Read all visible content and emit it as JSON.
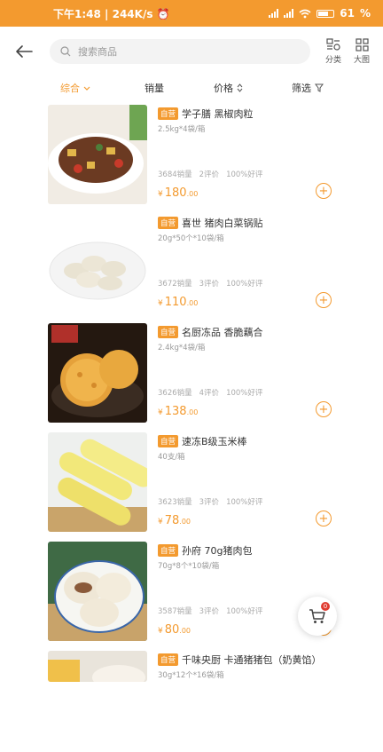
{
  "status": {
    "time": "下午1:48",
    "speed": "244K/s",
    "battery": "61"
  },
  "header": {
    "search_placeholder": "搜索商品",
    "category_label": "分类",
    "grid_label": "大图"
  },
  "sort": {
    "comprehensive": "综合",
    "sales": "销量",
    "price": "价格",
    "filter": "筛选"
  },
  "tag_label": "自营",
  "products": [
    {
      "name": "学子膳 黑椒肉粒",
      "spec": "2.5kg*4袋/箱",
      "sales": "3684销量",
      "reviews": "2评价",
      "rating": "100%好评",
      "price_int": "180",
      "price_dec": ".00"
    },
    {
      "name": "喜世 猪肉白菜锅贴",
      "spec": "20g*50个*10袋/箱",
      "sales": "3672销量",
      "reviews": "3评价",
      "rating": "100%好评",
      "price_int": "110",
      "price_dec": ".00"
    },
    {
      "name": "名厨冻品 香脆藕合",
      "spec": "2.4kg*4袋/箱",
      "sales": "3626销量",
      "reviews": "4评价",
      "rating": "100%好评",
      "price_int": "138",
      "price_dec": ".00"
    },
    {
      "name": "速冻B级玉米棒",
      "spec": "40支/箱",
      "sales": "3623销量",
      "reviews": "3评价",
      "rating": "100%好评",
      "price_int": "78",
      "price_dec": ".00"
    },
    {
      "name": "孙府 70g猪肉包",
      "spec": "70g*8个*10袋/箱",
      "sales": "3587销量",
      "reviews": "3评价",
      "rating": "100%好评",
      "price_int": "80",
      "price_dec": ".00"
    },
    {
      "name": "千味央厨 卡通猪猪包（奶黄馅）",
      "spec": "30g*12个*16袋/箱",
      "sales": "",
      "reviews": "",
      "rating": "",
      "price_int": "",
      "price_dec": ""
    }
  ],
  "cart": {
    "badge": "0"
  },
  "colors": {
    "accent": "#f39a2f"
  }
}
